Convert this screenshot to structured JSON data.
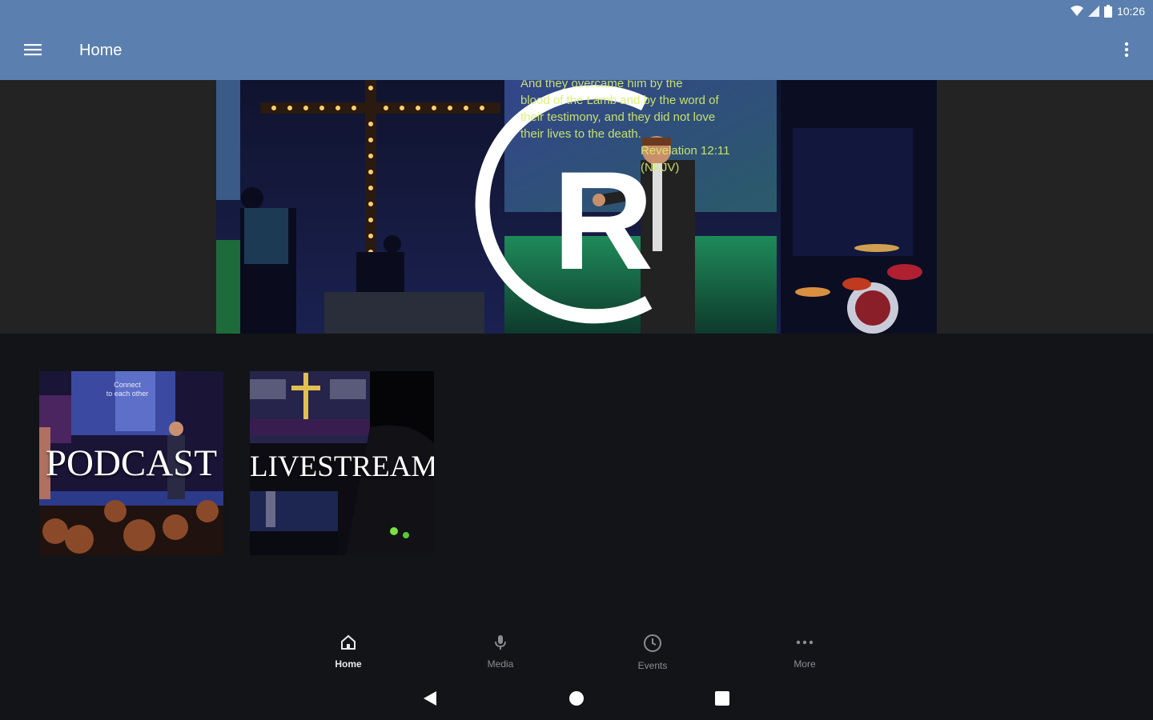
{
  "status_bar": {
    "time": "10:26",
    "icons": [
      "wifi-icon",
      "signal-icon",
      "battery-icon"
    ]
  },
  "app_bar": {
    "title": "Home",
    "menu_icon": "hamburger-menu-icon",
    "overflow_icon": "more-vertical-icon",
    "color": "#5b7fae"
  },
  "hero": {
    "logo_letter": "R",
    "screen_text": [
      "And they overcame him by the",
      "blood of the Lamb and by the word of",
      "their testimony, and they did not love",
      "their lives to the death.",
      "Revelation 12:11 (NKJV)"
    ]
  },
  "tiles": [
    {
      "label": "PODCAST",
      "sign_text": [
        "Connect",
        "to each other"
      ]
    },
    {
      "label": "LIVESTREAM"
    }
  ],
  "bottom_nav": {
    "items": [
      {
        "label": "Home",
        "icon": "home-icon",
        "active": true
      },
      {
        "label": "Media",
        "icon": "microphone-icon",
        "active": false
      },
      {
        "label": "Events",
        "icon": "clock-icon",
        "active": false
      },
      {
        "label": "More",
        "icon": "more-horizontal-icon",
        "active": false
      }
    ]
  },
  "system_nav": {
    "back_icon": "back-triangle-icon",
    "home_icon": "home-circle-icon",
    "recents_icon": "recents-square-icon"
  },
  "colors": {
    "background": "#121417",
    "hero_band": "#232323",
    "accent": "#5b7fae"
  }
}
